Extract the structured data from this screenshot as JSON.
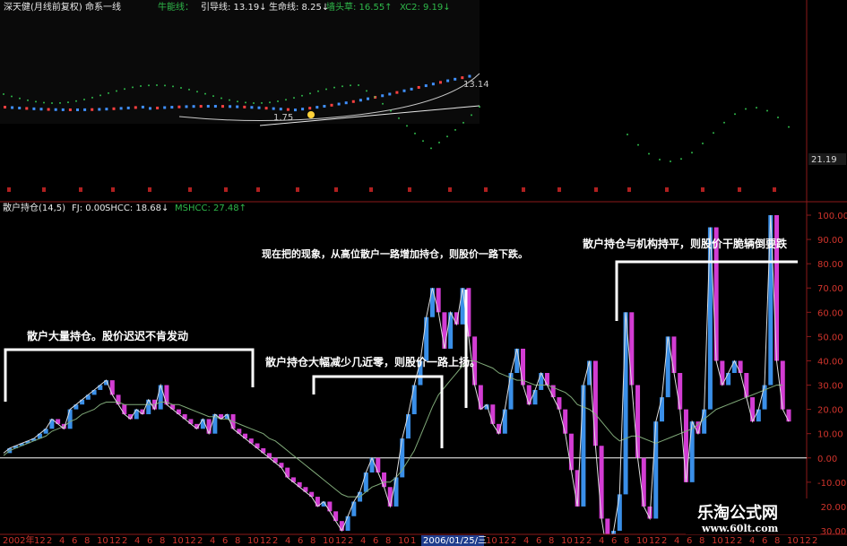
{
  "header": {
    "title": "深天健(月线前复权) 命系一线",
    "niu": "牛能线：",
    "yindao": "引导线: 13.19↓",
    "shengming": "生命线: 8.25↓",
    "qiangtou": "墙头草: 16.55↑",
    "xc2": "XC2: 9.19↓"
  },
  "top_panel": {
    "price_labels": [
      "13.14",
      "1.75",
      "16.55"
    ],
    "right_value": "21.19"
  },
  "bottom_header": {
    "name": "散户持仓(14,5)",
    "fj": "FJ: 0.00",
    "shcc": "SHCC: 18.68↓",
    "mshcc": "MSHCC: 27.48↑"
  },
  "annotations": {
    "a1": "散户大量持仓。股价迟迟不肯发动",
    "a2": "散户持仓大幅减少几近零，则股价一路上扬。",
    "a3": "现在把的现象，从高位散户一路增加持仓，则股价一路下跌。",
    "a4": "散户持仓与机构持平，则股价干脆辆倒要跌"
  },
  "xaxis_labels": [
    "2002年",
    "12",
    "2",
    "4",
    "6",
    "8",
    "10",
    "12",
    "2",
    "4",
    "6",
    "8",
    "10",
    "12",
    "2",
    "4",
    "6",
    "8",
    "10",
    "12",
    "2",
    "4",
    "6",
    "8",
    "10",
    "12",
    "2",
    "4",
    "6",
    "8",
    "10",
    "1",
    "2006/01/25/三",
    "10",
    "12",
    "2",
    "4",
    "6",
    "8",
    "10",
    "12",
    "2",
    "4",
    "6",
    "8",
    "10",
    "12",
    "2",
    "4",
    "6",
    "8",
    "10",
    "12",
    "2",
    "4",
    "6",
    "8",
    "10",
    "12",
    "2"
  ],
  "watermark": {
    "cn": "乐淘公式网",
    "url": "www.60lt.com"
  },
  "colors": {
    "pos": "#3a8fe8",
    "neg": "#d33cd3",
    "line": "#dddddd",
    "ma": "#7fa878",
    "axis": "#8b1a1a",
    "top_dot_red": "#ff4040",
    "top_dot_blue": "#4090ff",
    "green_dot": "#2fb84a"
  },
  "chart_data": {
    "type": "bar",
    "title": "散户持仓(14,5)",
    "ylim": [
      -30,
      100
    ],
    "yticks": [
      100,
      90,
      80,
      70,
      60,
      50,
      40,
      30,
      20,
      10,
      0,
      -10,
      -20,
      -30
    ],
    "series": [
      {
        "name": "SHCC",
        "values": [
          2,
          4,
          5,
          6,
          7,
          8,
          10,
          12,
          16,
          14,
          12,
          20,
          22,
          24,
          26,
          28,
          30,
          32,
          26,
          22,
          18,
          16,
          20,
          18,
          24,
          20,
          30,
          22,
          20,
          18,
          16,
          14,
          12,
          16,
          10,
          18,
          16,
          18,
          12,
          10,
          8,
          6,
          4,
          2,
          0,
          -2,
          -4,
          -8,
          -10,
          -12,
          -14,
          -16,
          -20,
          -18,
          -22,
          -26,
          -30,
          -24,
          -18,
          -14,
          -6,
          0,
          -6,
          -12,
          -20,
          -8,
          8,
          18,
          30,
          40,
          58,
          70,
          60,
          45,
          60,
          55,
          70,
          50,
          30,
          20,
          22,
          14,
          10,
          20,
          35,
          45,
          30,
          22,
          28,
          35,
          30,
          25,
          20,
          10,
          -5,
          -20,
          30,
          40,
          5,
          -25,
          -40,
          -30,
          -15,
          60,
          30,
          0,
          -20,
          -25,
          15,
          25,
          50,
          35,
          20,
          -10,
          15,
          10,
          20,
          95,
          40,
          30,
          35,
          40,
          35,
          25,
          15,
          20,
          30,
          100,
          40,
          20,
          15
        ]
      },
      {
        "name": "MSHCC",
        "values": [
          1,
          3,
          4,
          5,
          6,
          7,
          8,
          9,
          11,
          12,
          13,
          15,
          16,
          18,
          19,
          20,
          22,
          23,
          23,
          23,
          22,
          22,
          22,
          22,
          22,
          22,
          23,
          23,
          22,
          22,
          21,
          20,
          19,
          18,
          17,
          17,
          16,
          16,
          15,
          14,
          13,
          12,
          11,
          10,
          8,
          7,
          5,
          3,
          1,
          -1,
          -3,
          -5,
          -7,
          -9,
          -11,
          -13,
          -15,
          -16,
          -16,
          -16,
          -14,
          -12,
          -11,
          -10,
          -10,
          -8,
          -5,
          -1,
          3,
          9,
          15,
          21,
          26,
          29,
          32,
          35,
          38,
          40,
          40,
          39,
          38,
          37,
          35,
          34,
          33,
          32,
          32,
          31,
          30,
          30,
          30,
          29,
          28,
          27,
          25,
          22,
          21,
          20,
          18,
          15,
          12,
          9,
          7,
          8,
          9,
          9,
          8,
          7,
          6,
          7,
          8,
          9,
          10,
          11,
          12,
          14,
          16,
          18,
          20,
          21,
          22,
          23,
          24,
          25,
          26,
          27,
          28,
          29,
          30,
          30
        ]
      }
    ]
  }
}
